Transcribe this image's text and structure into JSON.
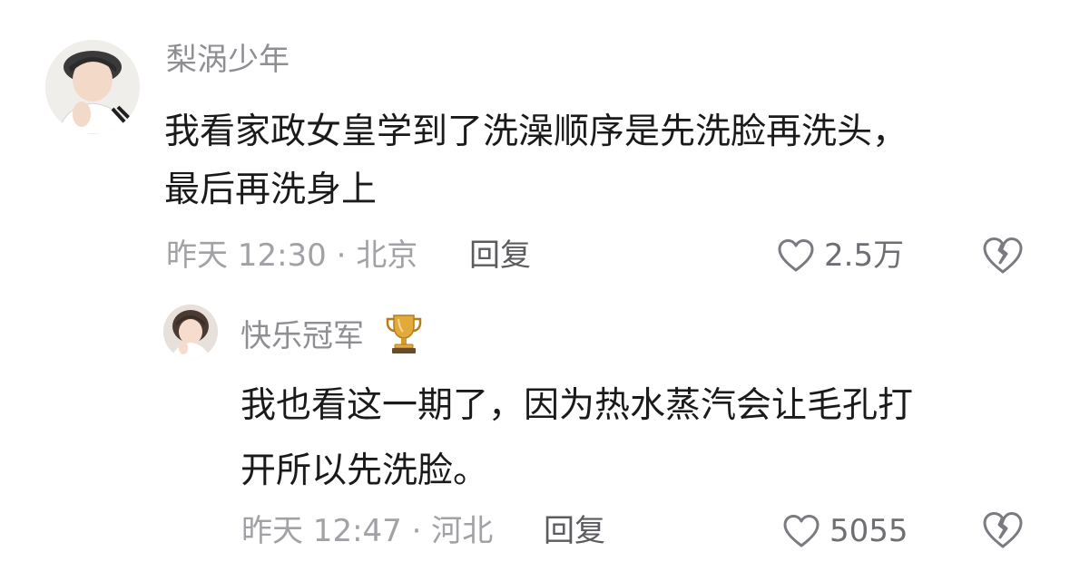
{
  "comment": {
    "author": "梨涡少年",
    "text_lines": [
      "我看家政女皇学到了洗澡顺序是先洗脸再洗头，",
      "最后再洗身上"
    ],
    "time_location": "昨天 12:30 · 北京",
    "reply_label": "回复",
    "like_count": "2.5万",
    "avatar_icon": "user-avatar-photo",
    "like_icon": "heart-outline-icon",
    "dislike_icon": "broken-heart-icon"
  },
  "reply": {
    "author": "快乐冠军",
    "badge_icon": "trophy-icon",
    "text_lines": [
      "我也看这一期了，因为热水蒸汽会让毛孔打",
      "开所以先洗脸。"
    ],
    "time_location": "昨天 12:47 · 河北",
    "reply_label": "回复",
    "like_count": "5055",
    "avatar_icon": "user-avatar-photo",
    "like_icon": "heart-outline-icon",
    "dislike_icon": "broken-heart-icon"
  },
  "colors": {
    "username": "#8e8e93",
    "body_text": "#1a1a1a",
    "meta_text": "#a1a1a6",
    "reply_text": "#5b5b60",
    "icon_stroke": "#7a7a80",
    "trophy_gold": "#e2a93b"
  }
}
